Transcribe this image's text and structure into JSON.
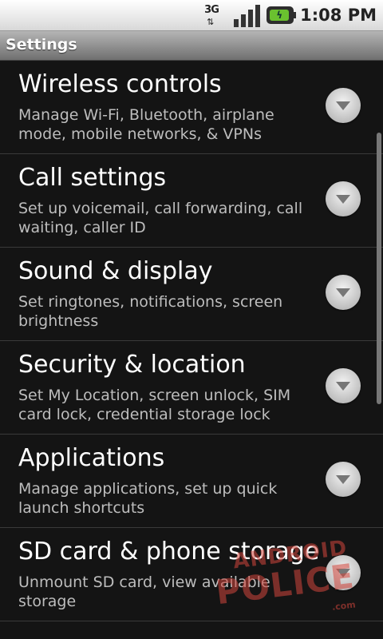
{
  "status_bar": {
    "network_type": "3G",
    "network_icon": "3g-data-icon",
    "signal_icon": "signal-strength-icon",
    "battery_icon": "battery-charging-icon",
    "time": "1:08 PM"
  },
  "title_bar": {
    "title": "Settings"
  },
  "settings": [
    {
      "label": "Wireless controls",
      "summary": "Manage Wi-Fi, Bluetooth, airplane mode, mobile networks, & VPNs"
    },
    {
      "label": "Call settings",
      "summary": "Set up voicemail, call forwarding, call waiting, caller ID"
    },
    {
      "label": "Sound & display",
      "summary": "Set ringtones, notifications, screen brightness"
    },
    {
      "label": "Security & location",
      "summary": "Set My Location, screen unlock, SIM card lock, credential storage lock"
    },
    {
      "label": "Applications",
      "summary": "Manage applications, set up quick launch shortcuts"
    },
    {
      "label": "SD card & phone storage",
      "summary": "Unmount SD card, view available storage"
    }
  ],
  "watermark": {
    "line1": "ANDROID",
    "line2": "POLICE",
    "line3": ".com"
  },
  "colors": {
    "background": "#141414",
    "title_bar": "#8f8f8f",
    "label": "#ffffff",
    "summary": "#bdbdbd"
  }
}
